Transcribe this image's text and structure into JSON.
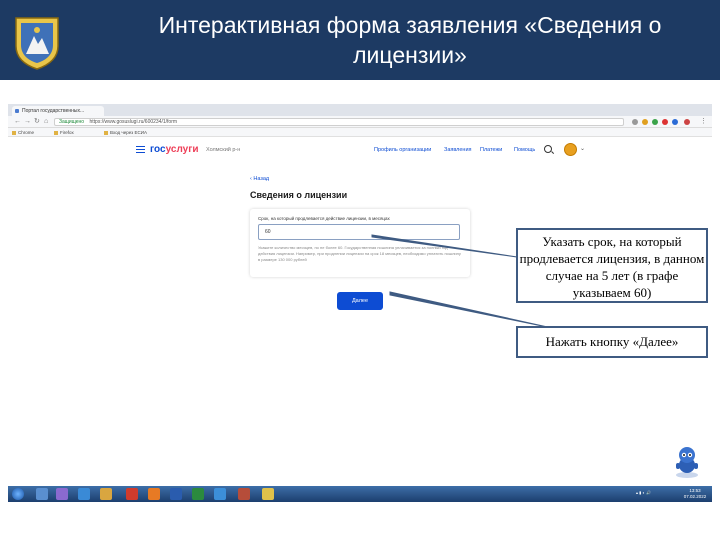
{
  "slide": {
    "title": "Интерактивная форма заявления «Сведения о лицензии»"
  },
  "browser": {
    "tab_title": "Портал государственных...",
    "url_secure": "Защищено",
    "url": "https://www.gosuslugi.ru/600234/1/form",
    "bookmarks": [
      "Chrome",
      "Firefox",
      "Вход через ЕСИА"
    ]
  },
  "site": {
    "logo_part1": "гос",
    "logo_part2": "услуги",
    "region": "Холмский р-н",
    "nav": {
      "profile": "Профиль организации",
      "applications": "Заявления",
      "payments": "Платежи",
      "help": "Помощь"
    },
    "back": "Назад",
    "heading": "Сведения о лицензии",
    "field_label": "Срок, на который продлевается действие лицензии, в месяцах",
    "field_value": "60",
    "hint": "Укажите количество месяцев, но не более 60. Государственная пошлина уплачивается за полный год действия лицензии. Например, при продлении лицензии на срок 18 месяцев, необходимо уплатить пошлину в размере 130 000 рублей",
    "next_button": "Далее"
  },
  "taskbar": {
    "time": "13:53",
    "date": "07.02.2022"
  },
  "callouts": {
    "first": "Указать срок, на который продлевается лицензия, в данном случае на 5 лет (в графе указываем 60)",
    "second": "Нажать кнопку «Далее»"
  },
  "colors": {
    "banner": "#1d3a63",
    "accent_blue": "#0d4cd3",
    "logo_red": "#ee3f58",
    "callout_border": "#3f5b82"
  }
}
